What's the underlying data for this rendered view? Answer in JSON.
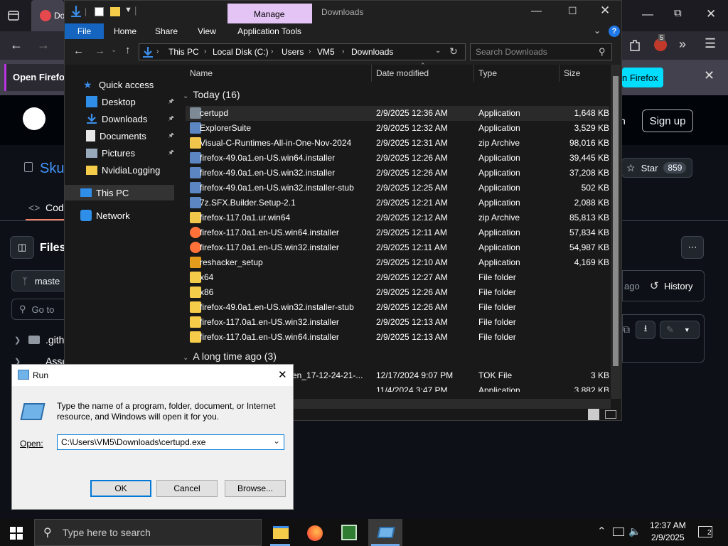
{
  "browser": {
    "tab_label": "Do",
    "notification_label": "Open Firefox",
    "notification_button": "n Firefox",
    "badge_count": "5"
  },
  "github": {
    "sign_up": "Sign up",
    "sign_in_partial": "n",
    "repo_partial": "Sku",
    "star_label": "Star",
    "star_count": "859",
    "code_tab": "Cod",
    "files_label": "Files",
    "branch_partial": "maste",
    "goto_partial": "Go to",
    "folder1_partial": ".gith",
    "folder2_partial": "Asse",
    "ago_label": "ago",
    "history_label": "History"
  },
  "explorer": {
    "manage_label": "Manage",
    "window_title": "Downloads",
    "ribbon_tabs": [
      "File",
      "Home",
      "Share",
      "View",
      "Application Tools"
    ],
    "breadcrumb": [
      "This PC",
      "Local Disk (C:)",
      "Users",
      "VM5",
      "Downloads"
    ],
    "search_placeholder": "Search Downloads",
    "nav": {
      "quick_access": "Quick access",
      "desktop": "Desktop",
      "downloads": "Downloads",
      "documents": "Documents",
      "pictures": "Pictures",
      "nvidia": "NvidiaLogging",
      "this_pc": "This PC",
      "network": "Network"
    },
    "columns": {
      "name": "Name",
      "date": "Date modified",
      "type": "Type",
      "size": "Size"
    },
    "group_today": "Today (16)",
    "group_long_ago": "A long time ago (3)",
    "files": [
      {
        "name": "certupd",
        "date": "2/9/2025 12:36 AM",
        "type": "Application",
        "size": "1,648 KB",
        "icon": "app-icon"
      },
      {
        "name": "ExplorerSuite",
        "date": "2/9/2025 12:32 AM",
        "type": "Application",
        "size": "3,529 KB",
        "icon": "installer-icon"
      },
      {
        "name": "Visual-C-Runtimes-All-in-One-Nov-2024",
        "date": "2/9/2025 12:31 AM",
        "type": "zip Archive",
        "size": "98,016 KB",
        "icon": "zip-icon"
      },
      {
        "name": "firefox-49.0a1.en-US.win64.installer",
        "date": "2/9/2025 12:26 AM",
        "type": "Application",
        "size": "39,445 KB",
        "icon": "installer-icon"
      },
      {
        "name": "firefox-49.0a1.en-US.win32.installer",
        "date": "2/9/2025 12:26 AM",
        "type": "Application",
        "size": "37,208 KB",
        "icon": "installer-icon"
      },
      {
        "name": "firefox-49.0a1.en-US.win32.installer-stub",
        "date": "2/9/2025 12:25 AM",
        "type": "Application",
        "size": "502 KB",
        "icon": "installer-icon"
      },
      {
        "name": "7z.SFX.Builder.Setup-2.1",
        "date": "2/9/2025 12:21 AM",
        "type": "Application",
        "size": "2,088 KB",
        "icon": "installer-icon"
      },
      {
        "name": "firefox-117.0a1.ur.win64",
        "date": "2/9/2025 12:12 AM",
        "type": "zip Archive",
        "size": "85,813 KB",
        "icon": "zip-icon"
      },
      {
        "name": "firefox-117.0a1.en-US.win64.installer",
        "date": "2/9/2025 12:11 AM",
        "type": "Application",
        "size": "57,834 KB",
        "icon": "firefox-icon"
      },
      {
        "name": "firefox-117.0a1.en-US.win32.installer",
        "date": "2/9/2025 12:11 AM",
        "type": "Application",
        "size": "54,987 KB",
        "icon": "firefox-icon"
      },
      {
        "name": "reshacker_setup",
        "date": "2/9/2025 12:10 AM",
        "type": "Application",
        "size": "4,169 KB",
        "icon": "rh-icon"
      },
      {
        "name": "x64",
        "date": "2/9/2025 12:27 AM",
        "type": "File folder",
        "size": "",
        "icon": "folder-icon"
      },
      {
        "name": "x86",
        "date": "2/9/2025 12:26 AM",
        "type": "File folder",
        "size": "",
        "icon": "folder-icon"
      },
      {
        "name": "firefox-49.0a1.en-US.win32.installer-stub",
        "date": "2/9/2025 12:26 AM",
        "type": "File folder",
        "size": "",
        "icon": "folder-icon"
      },
      {
        "name": "firefox-117.0a1.en-US.win32.installer",
        "date": "2/9/2025 12:13 AM",
        "type": "File folder",
        "size": "",
        "icon": "folder-icon"
      },
      {
        "name": "firefox-117.0a1.en-US.win64.installer",
        "date": "2/9/2025 12:13 AM",
        "type": "File folder",
        "size": "",
        "icon": "folder-icon"
      }
    ],
    "old_files": [
      {
        "name": "en_17-12-24-21-...",
        "date": "12/17/2024 9:07 PM",
        "type": "TOK File",
        "size": "3 KB"
      },
      {
        "name": "",
        "date": "11/4/2024 3:47 PM",
        "type": "Application",
        "size": "3,882 KB"
      }
    ]
  },
  "run_dialog": {
    "title": "Run",
    "description_line1": "Type the name of a program, folder, document, or Internet",
    "description_line2": "resource, and Windows will open it for you.",
    "open_label": "Open:",
    "open_value": "C:\\Users\\VM5\\Downloads\\certupd.exe",
    "ok": "OK",
    "cancel": "Cancel",
    "browse": "Browse..."
  },
  "taskbar": {
    "search_placeholder": "Type here to search",
    "time": "12:37 AM",
    "date": "2/9/2025",
    "notification_count": "2"
  }
}
